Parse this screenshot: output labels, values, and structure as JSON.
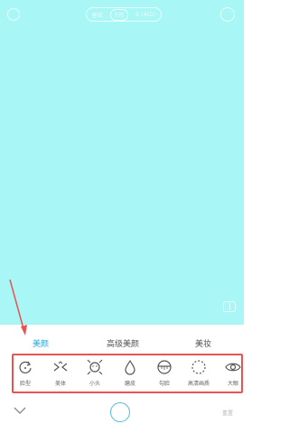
{
  "top_bar": {
    "aspect_options": [
      "竖拍",
      "方形",
      "9:16(D)"
    ],
    "selected_aspect": "方形"
  },
  "tabs": [
    {
      "label": "美颜",
      "active": true
    },
    {
      "label": "高级美颜",
      "active": false
    },
    {
      "label": "美妆",
      "active": false
    }
  ],
  "beauty_options": [
    {
      "label": "脸型",
      "icon": "face-shape-icon"
    },
    {
      "label": "美体",
      "icon": "body-icon"
    },
    {
      "label": "小头",
      "icon": "small-head-icon"
    },
    {
      "label": "磨皮",
      "icon": "smooth-skin-icon"
    },
    {
      "label": "勾脸",
      "icon": "contour-icon"
    },
    {
      "label": "高清画质",
      "icon": "hd-quality-icon"
    },
    {
      "label": "大眼",
      "icon": "big-eyes-icon"
    }
  ],
  "bottom_bar": {
    "reset_label": "重置"
  },
  "colors": {
    "camera_background": "#a8f6f6",
    "accent": "#2aa8d8",
    "highlight_box": "#e85353"
  }
}
